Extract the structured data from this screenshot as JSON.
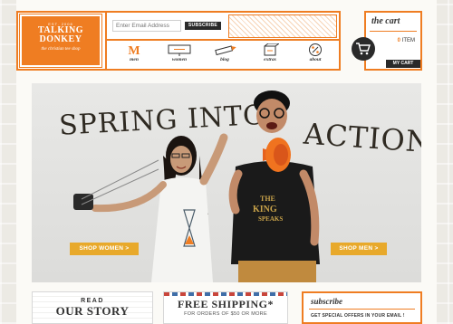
{
  "header": {
    "logo": {
      "est": "EST. 2008",
      "line1": "TALKING",
      "line2": "DONKEY",
      "tagline": "the christian tee shop"
    },
    "email_placeholder": "Enter Email Address",
    "subscribe_label": "SUBSCRIBE",
    "nav": [
      {
        "label": "men",
        "icon": "m-letter-icon"
      },
      {
        "label": "women",
        "icon": "sign-icon"
      },
      {
        "label": "blog",
        "icon": "pencil-icon"
      },
      {
        "label": "extras",
        "icon": "box-icon"
      },
      {
        "label": "about",
        "icon": "percent-circle-icon"
      }
    ]
  },
  "cart": {
    "title": "the cart",
    "count": "0",
    "count_suffix": "ITEM",
    "button_label": "MY CART"
  },
  "hero": {
    "headline_left": "SPRING INTO",
    "headline_right": "ACTION",
    "shop_women": "SHOP WOMEN >",
    "shop_men": "SHOP MEN >"
  },
  "bottom": {
    "story_read": "READ",
    "story_title": "OUR STORY",
    "shipping_title": "FREE SHIPPING*",
    "shipping_sub": "FOR ORDERS OF $50 OR MORE",
    "subscribe_title": "subscribe",
    "subscribe_sub": "GET SPECIAL OFFERS IN YOUR EMAIL !"
  },
  "colors": {
    "accent": "#ef7d22",
    "button_gold": "#e8a92b",
    "dark": "#2a2a2a"
  }
}
